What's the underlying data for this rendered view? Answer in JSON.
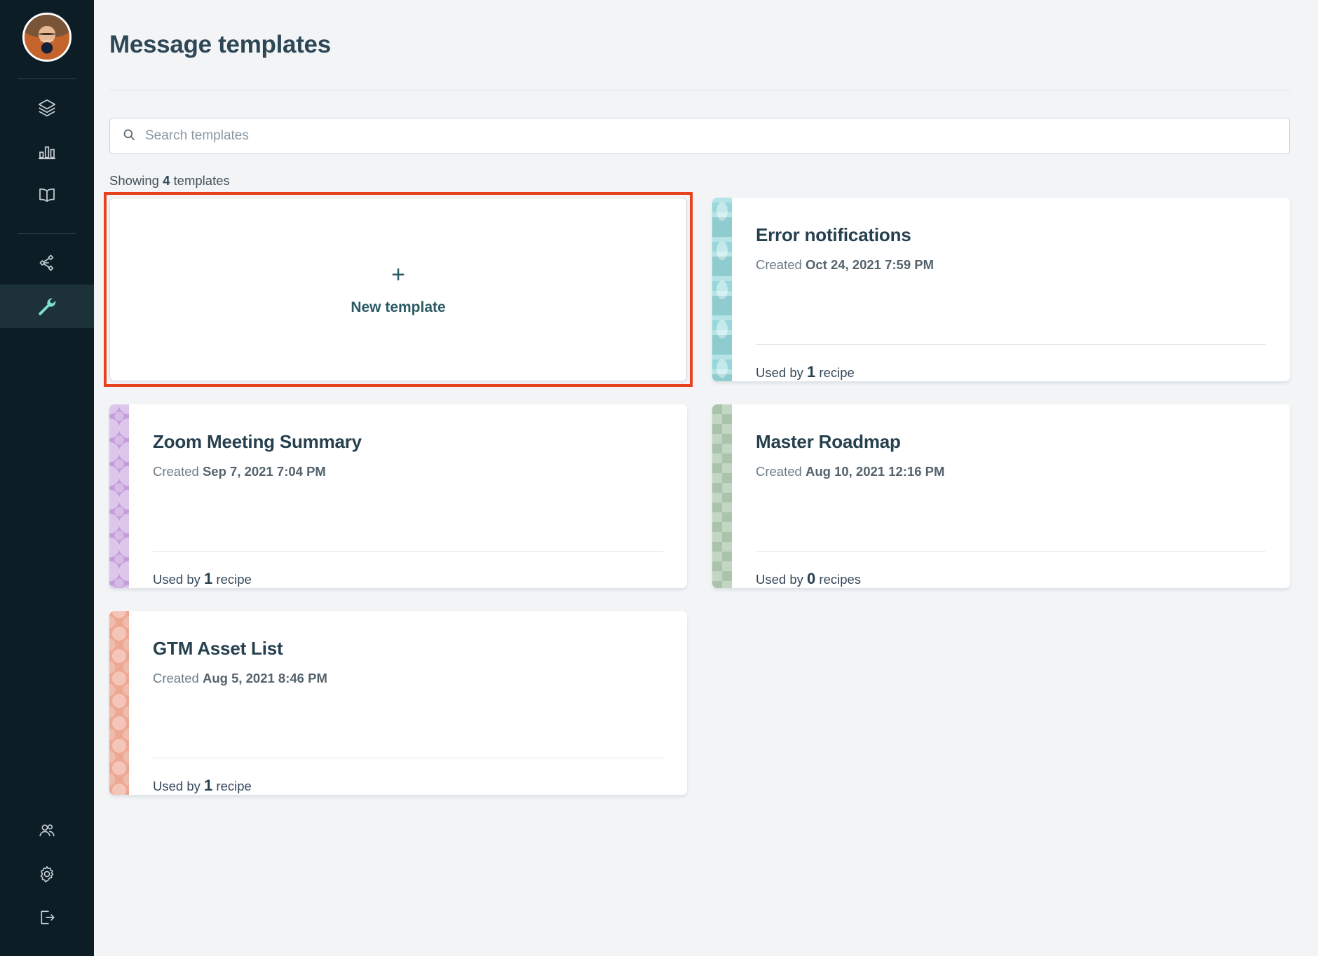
{
  "sidebar": {
    "avatar": {
      "name": "user-avatar"
    },
    "nav_top": [
      {
        "id": "layers",
        "icon": "layers-icon",
        "label": "Layers"
      },
      {
        "id": "analytics",
        "icon": "bar-chart-icon",
        "label": "Analytics"
      },
      {
        "id": "library",
        "icon": "book-icon",
        "label": "Library"
      }
    ],
    "nav_mid": [
      {
        "id": "connections",
        "icon": "share-nodes-icon",
        "label": "Connections",
        "active": false
      },
      {
        "id": "tools",
        "icon": "wrench-icon",
        "label": "Tools",
        "active": true
      }
    ],
    "nav_bottom": [
      {
        "id": "team",
        "icon": "users-icon",
        "label": "Team"
      },
      {
        "id": "settings",
        "icon": "gear-icon",
        "label": "Settings"
      },
      {
        "id": "logout",
        "icon": "logout-icon",
        "label": "Log out"
      }
    ]
  },
  "header": {
    "title": "Message templates"
  },
  "search": {
    "placeholder": "Search templates",
    "value": "",
    "icon": "search-icon"
  },
  "results": {
    "showing_prefix": "Showing ",
    "count": "4",
    "showing_suffix": " templates"
  },
  "new_template_card": {
    "plus": "+",
    "label": "New template"
  },
  "labels": {
    "created_prefix": "Created ",
    "used_prefix": "Used by ",
    "recipe_singular": " recipe",
    "recipe_plural": " recipes"
  },
  "templates": [
    {
      "name": "Error notifications",
      "created": "Oct 24, 2021 7:59 PM",
      "used_count": "1",
      "used_unit": " recipe",
      "stripe_style": "stripe-teal",
      "stripe_color": "#96d7db"
    },
    {
      "name": "Zoom Meeting Summary",
      "created": "Sep 7, 2021 7:04 PM",
      "used_count": "1",
      "used_unit": " recipe",
      "stripe_style": "stripe-purple",
      "stripe_color": "#c49ddb"
    },
    {
      "name": "Master Roadmap",
      "created": "Aug 10, 2021 12:16 PM",
      "used_count": "0",
      "used_unit": " recipes",
      "stripe_style": "stripe-green",
      "stripe_color": "#a9c4ab"
    },
    {
      "name": "GTM Asset List",
      "created": "Aug 5, 2021 8:46 PM",
      "used_count": "1",
      "used_unit": " recipe",
      "stripe_style": "stripe-orange",
      "stripe_color": "#eda894"
    }
  ],
  "annotation": {
    "highlight_color": "#e8411e",
    "target": "new-template-card"
  }
}
